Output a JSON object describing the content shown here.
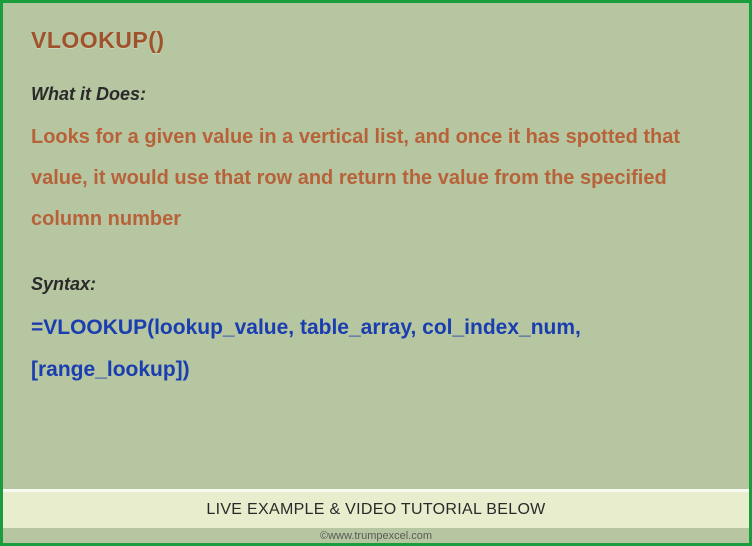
{
  "title": "VLOOKUP()",
  "what_it_does_label": "What it Does:",
  "description": "Looks for a given value in a vertical list, and once it has spotted that value, it would use that row and return the value from the specified column number",
  "syntax_label": "Syntax:",
  "syntax_text": "=VLOOKUP(lookup_value, table_array, col_index_num, [range_lookup])",
  "footer_text": "LIVE EXAMPLE & VIDEO TUTORIAL BELOW",
  "attribution": "©www.trumpexcel.com"
}
